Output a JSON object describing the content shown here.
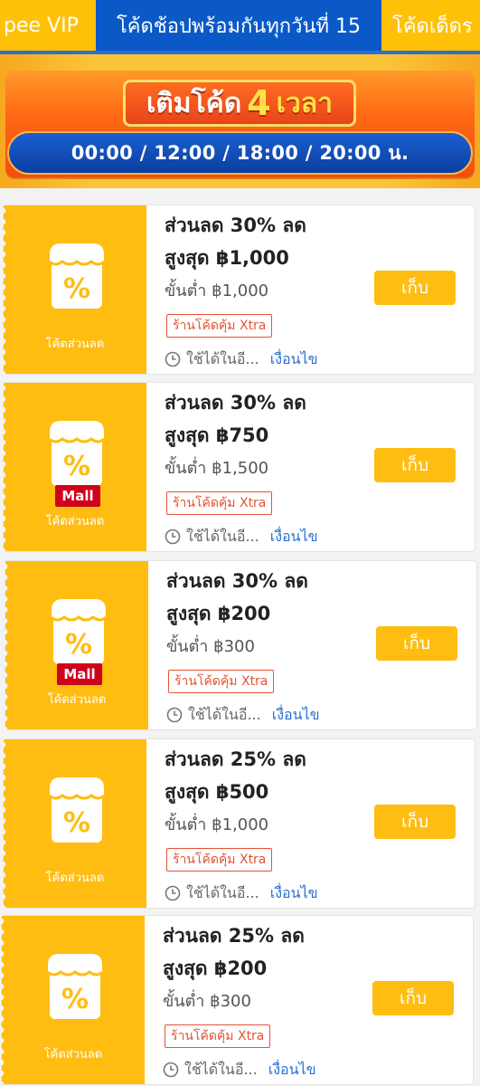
{
  "tabs": [
    {
      "label": "pee VIP"
    },
    {
      "label": "โค้ดช้อปพร้อมกันทุกวันที่ 15"
    },
    {
      "label": "โค้ดเด็ดร"
    }
  ],
  "banner": {
    "title_prefix": "เติมโค้ด",
    "title_number": "4",
    "title_suffix": "เวลา",
    "times": "00:00 / 12:00 / 18:00 / 20:00 น."
  },
  "coupons": [
    {
      "left_label": "โค้ดส่วนลด",
      "mall": "",
      "title": "ส่วนลด 30% ลด",
      "cap": "สูงสุด ฿1,000",
      "min_spend": "ขั้นต่ำ ฿1,000",
      "tag": "ร้านโค้ดคุ้ม Xtra",
      "valid": "ใช้ได้ในอี...",
      "conditions": "เงื่อนไข",
      "button": "เก็บ"
    },
    {
      "left_label": "โค้ดส่วนลด",
      "mall": "Mall",
      "title": "ส่วนลด 30% ลด",
      "cap": "สูงสุด ฿750",
      "min_spend": "ขั้นต่ำ ฿1,500",
      "tag": "ร้านโค้ดคุ้ม Xtra",
      "valid": "ใช้ได้ในอี...",
      "conditions": "เงื่อนไข",
      "button": "เก็บ"
    },
    {
      "left_label": "โค้ดส่วนลด",
      "mall": "Mall",
      "title": "ส่วนลด 30% ลด",
      "cap": "สูงสุด ฿200",
      "min_spend": "ขั้นต่ำ ฿300",
      "tag": "ร้านโค้ดคุ้ม Xtra",
      "valid": "ใช้ได้ในอี...",
      "conditions": "เงื่อนไข",
      "button": "เก็บ"
    },
    {
      "left_label": "โค้ดส่วนลด",
      "mall": "",
      "title": "ส่วนลด 25% ลด",
      "cap": "สูงสุด ฿500",
      "min_spend": "ขั้นต่ำ ฿1,000",
      "tag": "ร้านโค้ดคุ้ม Xtra",
      "valid": "ใช้ได้ในอี...",
      "conditions": "เงื่อนไข",
      "button": "เก็บ"
    },
    {
      "left_label": "โค้ดส่วนลด",
      "mall": "",
      "title": "ส่วนลด 25% ลด",
      "cap": "สูงสุด ฿200",
      "min_spend": "ขั้นต่ำ ฿300",
      "tag": "ร้านโค้ดคุ้ม Xtra",
      "valid": "ใช้ได้ในอี...",
      "conditions": "เงื่อนไข",
      "button": "เก็บ"
    }
  ],
  "colors": {
    "brand_yellow": "#ffbd12",
    "active_tab_blue": "#0a59c7",
    "mall_red": "#d0011b",
    "tag_red": "#e55235",
    "link_blue": "#2a6fd6"
  }
}
